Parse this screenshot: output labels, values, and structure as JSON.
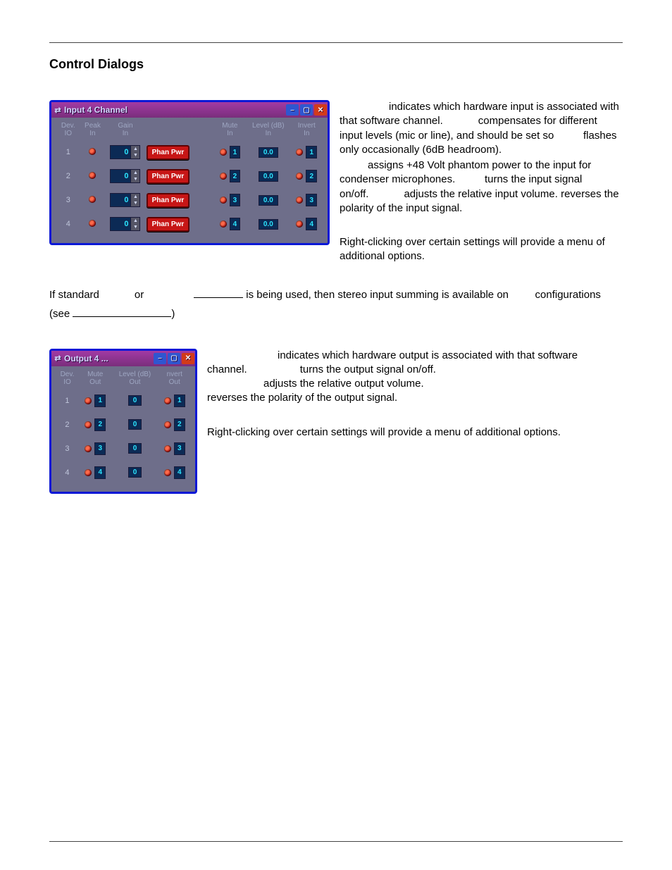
{
  "section_title": "Control Dialogs",
  "input_dialog": {
    "title": "Input 4 Channel",
    "headers": {
      "dev": "Dev.\nIO",
      "peak": "Peak\nIn",
      "gain": "Gain\nIn",
      "mute": "Mute\nIn",
      "level": "Level (dB)\nIn",
      "invert": "Invert\nIn"
    },
    "phan_label": "Phan Pwr",
    "rows": [
      {
        "dev": "1",
        "gain": "0",
        "mute_tag": "1",
        "level": "0.0",
        "invert_tag": "1"
      },
      {
        "dev": "2",
        "gain": "0",
        "mute_tag": "2",
        "level": "0.0",
        "invert_tag": "2"
      },
      {
        "dev": "3",
        "gain": "0",
        "mute_tag": "3",
        "level": "0.0",
        "invert_tag": "3"
      },
      {
        "dev": "4",
        "gain": "0",
        "mute_tag": "4",
        "level": "0.0",
        "invert_tag": "4"
      }
    ]
  },
  "input_para": {
    "p1a": "indicates which hardware input is associated with that software channel.",
    "p1b": "compensates for different input levels (mic or line), and should be set so",
    "p1c": "flashes only occasionally (6dB headroom).",
    "p2a": "assigns +48 Volt phantom power to the input for condenser microphones.",
    "p2b": "turns the input signal on/off.",
    "p2c": "adjusts the relative input volume.",
    "p2d": "reverses the polarity of the input signal.",
    "note": "Right-clicking over certain settings will provide a menu of additional options."
  },
  "mid_para": {
    "t1": "If standard",
    "t2": "or",
    "t3": "is being used, then stereo input summing is available on",
    "t4": "configurations (see",
    "t5": ")"
  },
  "output_dialog": {
    "title": "Output 4 ...",
    "headers": {
      "dev": "Dev.\nIO",
      "mute": "Mute\nOut",
      "level": "Level (dB)\nOut",
      "invert": "nvert\nOut"
    },
    "rows": [
      {
        "dev": "1",
        "mute_tag": "1",
        "level": "0",
        "invert_tag": "1"
      },
      {
        "dev": "2",
        "mute_tag": "2",
        "level": "0",
        "invert_tag": "2"
      },
      {
        "dev": "3",
        "mute_tag": "3",
        "level": "0",
        "invert_tag": "3"
      },
      {
        "dev": "4",
        "mute_tag": "4",
        "level": "0",
        "invert_tag": "4"
      }
    ]
  },
  "output_para": {
    "p1a": "indicates which hardware output is associated with that software channel.",
    "p1b": "turns the output signal on/off.",
    "p1c": "adjusts the relative output volume.",
    "p1d": "reverses the polarity of the output signal.",
    "note": "Right-clicking over certain settings will provide a menu of additional options."
  }
}
